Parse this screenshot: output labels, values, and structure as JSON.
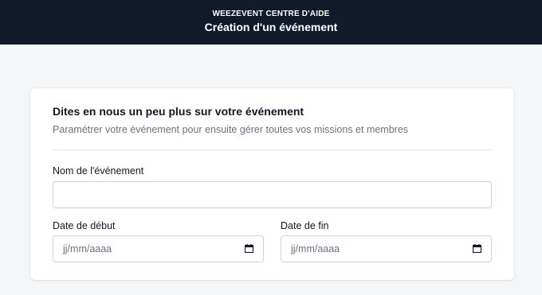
{
  "header": {
    "kicker": "WEEZEVENT CENTRE D'AIDE",
    "title": "Création d'un événement"
  },
  "card": {
    "title": "Dites en nous un peu plus sur votre événement",
    "subtitle": "Paramétrer votre événement pour ensuite gérer toutes vos missions et membres"
  },
  "form": {
    "event_name_label": "Nom de l'événement",
    "event_name_value": "",
    "start_date_label": "Date de début",
    "start_date_placeholder": "jj/mm/aaaa",
    "end_date_label": "Date de fin",
    "end_date_placeholder": "jj/mm/aaaa"
  },
  "icons": {
    "calendar": "calendar-icon"
  },
  "colors": {
    "header_bg": "#111a2b",
    "page_bg": "#f4f6f8"
  }
}
